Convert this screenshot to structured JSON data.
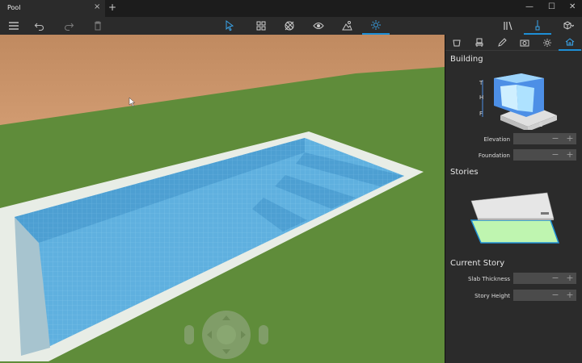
{
  "window": {
    "tab_title": "Pool",
    "tab_close_glyph": "×",
    "new_tab_glyph": "+",
    "minimize_glyph": "—",
    "maximize_glyph": "☐",
    "close_glyph": "✕"
  },
  "toolbar": {
    "left": [
      "hamburger-menu-icon",
      "undo-icon",
      "redo-icon",
      "delete-icon"
    ],
    "center": [
      "select-icon",
      "objects-icon",
      "materials-icon",
      "view-icon",
      "landscape-icon",
      "lighting-icon"
    ],
    "active_center": "lighting-icon",
    "right": [
      "library-icon",
      "paint-icon",
      "3d-view-icon"
    ]
  },
  "panel": {
    "tabs": [
      "objects-tab-icon",
      "furniture-tab-icon",
      "pencil-tab-icon",
      "camera-tab-icon",
      "sun-tab-icon",
      "building-tab-icon"
    ],
    "active_tab": "building-tab-icon",
    "building": {
      "title": "Building",
      "diagram_labels": {
        "t": "T",
        "h": "H",
        "f": "F",
        "e": "E"
      },
      "elevation_label": "Elevation",
      "foundation_label": "Foundation"
    },
    "stories": {
      "title": "Stories"
    },
    "current_story": {
      "title": "Current Story",
      "slab_label": "Slab Thickness",
      "height_label": "Story Height"
    },
    "stepper_minus": "−",
    "stepper_plus": "+"
  },
  "colors": {
    "accent": "#1e8fd6",
    "sky": "#c8936a",
    "grass": "#5f8c3a",
    "water": "#5fb0df"
  }
}
